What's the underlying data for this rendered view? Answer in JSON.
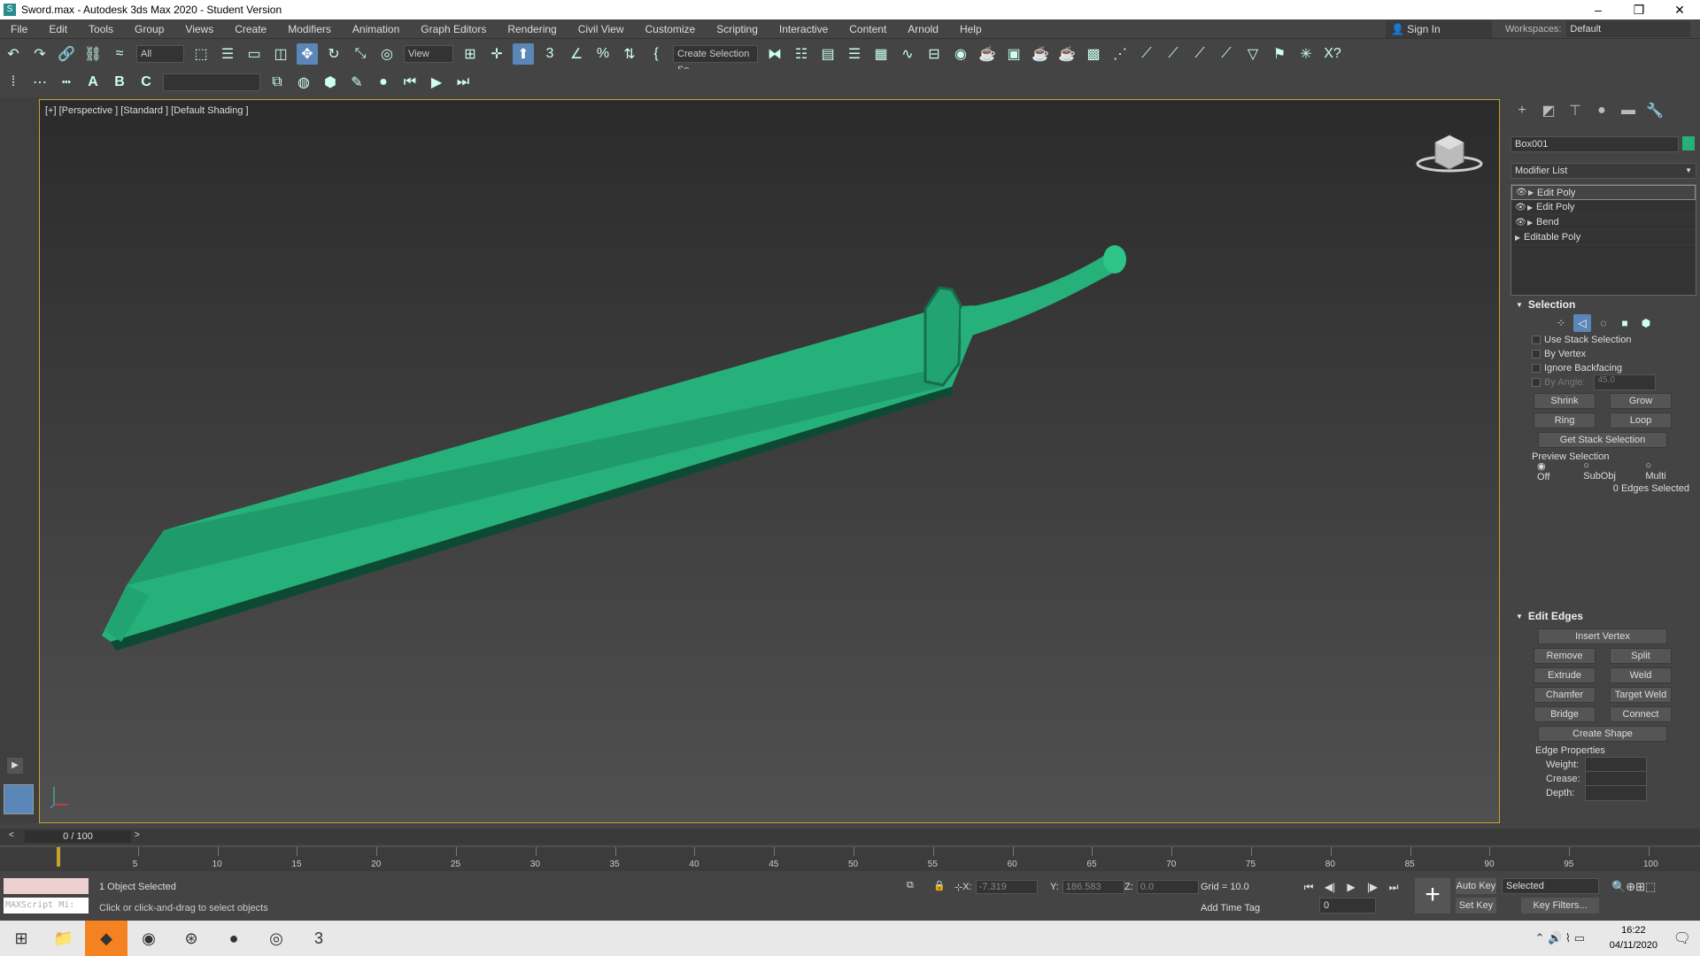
{
  "window": {
    "title": "Sword.max - Autodesk 3ds Max 2020 - Student Version"
  },
  "menu": [
    "File",
    "Edit",
    "Tools",
    "Group",
    "Views",
    "Create",
    "Modifiers",
    "Animation",
    "Graph Editors",
    "Rendering",
    "Civil View",
    "Customize",
    "Scripting",
    "Interactive",
    "Content",
    "Arnold",
    "Help"
  ],
  "header": {
    "signin": "Sign In",
    "workspaces_label": "Workspaces:",
    "workspace": "Default"
  },
  "toolbar": {
    "filter": "All",
    "ref_coord": "View",
    "selection_set": "Create Selection Se"
  },
  "viewport": {
    "label": "[+] [Perspective ] [Standard ] [Default Shading ]",
    "object_color": "#26b07a"
  },
  "command_panel": {
    "object_name": "Box001",
    "modifier_list": "Modifier List",
    "stack": [
      "Edit Poly",
      "Edit Poly",
      "Bend",
      "Editable Poly"
    ],
    "selection": {
      "title": "Selection",
      "use_stack": "Use Stack Selection",
      "by_vertex": "By Vertex",
      "ignore_backfacing": "Ignore Backfacing",
      "by_angle": "By Angle:",
      "angle_value": "45.0",
      "shrink": "Shrink",
      "grow": "Grow",
      "ring": "Ring",
      "loop": "Loop",
      "get_stack": "Get Stack Selection",
      "preview": "Preview Selection",
      "off": "Off",
      "subobj": "SubObj",
      "multi": "Multi",
      "status": "0 Edges Selected"
    },
    "edit_edges": {
      "title": "Edit Edges",
      "insert_vertex": "Insert Vertex",
      "remove": "Remove",
      "split": "Split",
      "extrude": "Extrude",
      "weld": "Weld",
      "chamfer": "Chamfer",
      "target_weld": "Target Weld",
      "bridge": "Bridge",
      "connect": "Connect",
      "create_shape": "Create Shape",
      "edge_props": "Edge Properties",
      "weight": "Weight:",
      "crease": "Crease:",
      "depth": "Depth:"
    }
  },
  "timeline": {
    "frame": "0 / 100",
    "ticks": [
      "5",
      "10",
      "15",
      "20",
      "25",
      "30",
      "35",
      "40",
      "45",
      "50",
      "55",
      "60",
      "65",
      "70",
      "75",
      "80",
      "85",
      "90",
      "95",
      "100"
    ]
  },
  "status": {
    "objects": "1 Object Selected",
    "prompt": "Click or click-and-drag to select objects",
    "maxscript": "MAXScript Mi:",
    "x_label": "X:",
    "x": "-7.319",
    "y_label": "Y:",
    "y": "186.583",
    "z_label": "Z:",
    "z": "0.0",
    "grid": "Grid = 10.0",
    "add_time_tag": "Add Time Tag",
    "auto_key": "Auto Key",
    "set_key": "Set Key",
    "key_mode": "Selected",
    "key_filters": "Key Filters...",
    "frame_field": "0"
  },
  "taskbar": {
    "time": "16:22",
    "date": "04/11/2020"
  }
}
